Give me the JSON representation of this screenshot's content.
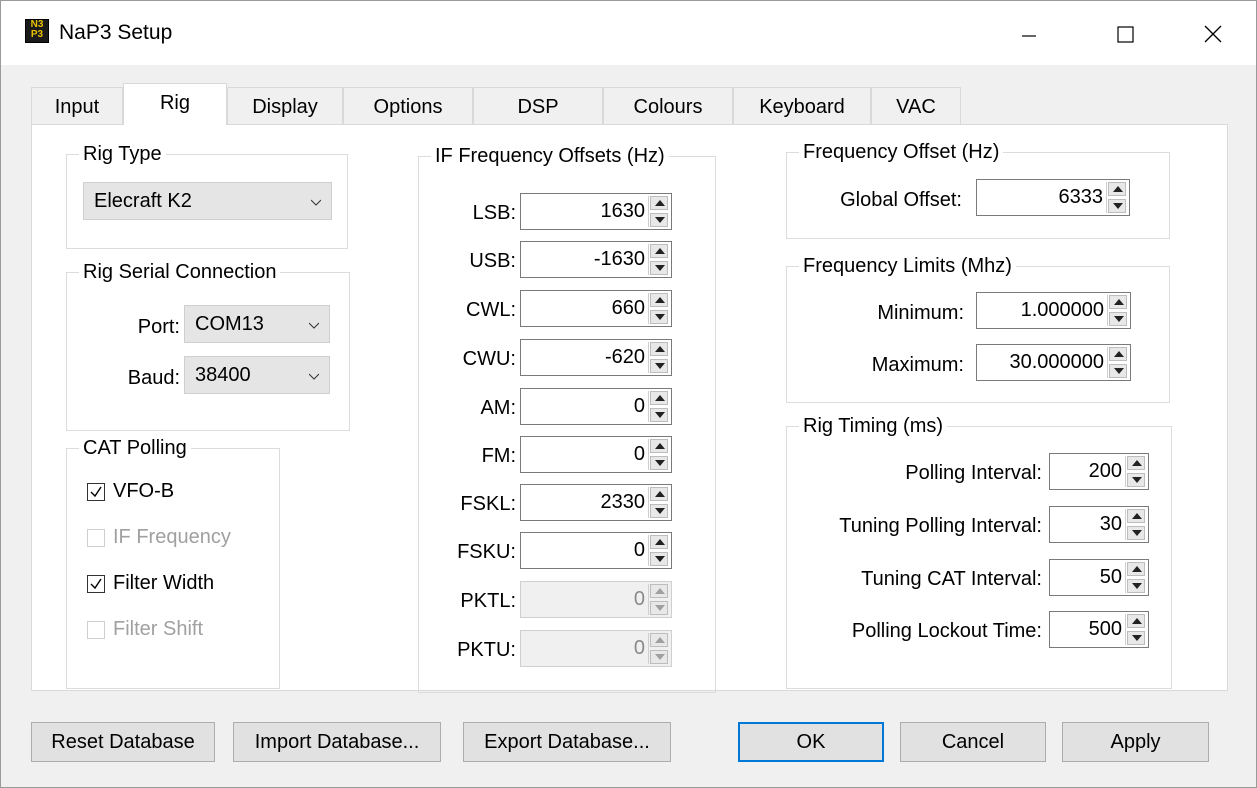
{
  "window": {
    "title": "NaP3 Setup",
    "icon": "nap3-app-icon"
  },
  "tabs": [
    {
      "label": "Input"
    },
    {
      "label": "Rig"
    },
    {
      "label": "Display"
    },
    {
      "label": "Options"
    },
    {
      "label": "DSP"
    },
    {
      "label": "Colours"
    },
    {
      "label": "Keyboard"
    },
    {
      "label": "VAC"
    }
  ],
  "active_tab": "Rig",
  "rig_type": {
    "legend": "Rig Type",
    "value": "Elecraft K2"
  },
  "serial": {
    "legend": "Rig Serial Connection",
    "port_label": "Port:",
    "port_value": "COM13",
    "baud_label": "Baud:",
    "baud_value": "38400"
  },
  "cat": {
    "legend": "CAT Polling",
    "items": [
      {
        "label": "VFO-B",
        "checked": true,
        "enabled": true
      },
      {
        "label": "IF Frequency",
        "checked": false,
        "enabled": false
      },
      {
        "label": "Filter Width",
        "checked": true,
        "enabled": true
      },
      {
        "label": "Filter Shift",
        "checked": false,
        "enabled": false
      }
    ]
  },
  "if_offsets": {
    "legend": "IF Frequency Offsets (Hz)",
    "rows": [
      {
        "label": "LSB:",
        "value": "1630",
        "enabled": true
      },
      {
        "label": "USB:",
        "value": "-1630",
        "enabled": true
      },
      {
        "label": "CWL:",
        "value": "660",
        "enabled": true
      },
      {
        "label": "CWU:",
        "value": "-620",
        "enabled": true
      },
      {
        "label": "AM:",
        "value": "0",
        "enabled": true
      },
      {
        "label": "FM:",
        "value": "0",
        "enabled": true
      },
      {
        "label": "FSKL:",
        "value": "2330",
        "enabled": true
      },
      {
        "label": "FSKU:",
        "value": "0",
        "enabled": true
      },
      {
        "label": "PKTL:",
        "value": "0",
        "enabled": false
      },
      {
        "label": "PKTU:",
        "value": "0",
        "enabled": false
      }
    ]
  },
  "freq_offset": {
    "legend": "Frequency Offset  (Hz)",
    "label": "Global Offset:",
    "value": "6333"
  },
  "freq_limits": {
    "legend": "Frequency Limits (Mhz)",
    "min_label": "Minimum:",
    "min_value": "1.000000",
    "max_label": "Maximum:",
    "max_value": "30.000000"
  },
  "timing": {
    "legend": "Rig Timing (ms)",
    "rows": [
      {
        "label": "Polling Interval:",
        "value": "200"
      },
      {
        "label": "Tuning Polling Interval:",
        "value": "30"
      },
      {
        "label": "Tuning CAT Interval:",
        "value": "50"
      },
      {
        "label": "Polling Lockout Time:",
        "value": "500"
      }
    ]
  },
  "buttons": {
    "reset": "Reset Database",
    "import": "Import Database...",
    "export": "Export Database...",
    "ok": "OK",
    "cancel": "Cancel",
    "apply": "Apply"
  },
  "accent_color": "#0078d7"
}
